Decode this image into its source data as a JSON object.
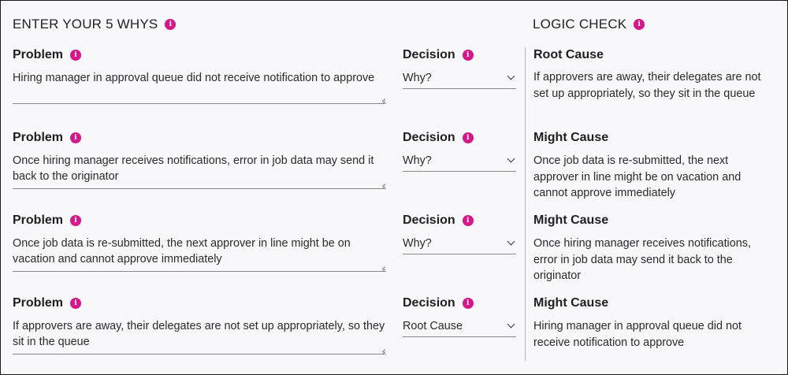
{
  "section_title": "ENTER YOUR 5 WHYS",
  "logic_title": "LOGIC CHECK",
  "rows": [
    {
      "problem_label": "Problem",
      "problem_text": "Hiring manager in approval queue did not receive notification to approve",
      "decision_label": "Decision",
      "decision_value": "Why?",
      "logic_label": "Root Cause",
      "logic_text": "If approvers are away, their delegates are not set up appropriately, so they sit in the queue"
    },
    {
      "problem_label": "Problem",
      "problem_text": "Once hiring manager receives notifications, error in job data may send it back to the originator",
      "decision_label": "Decision",
      "decision_value": "Why?",
      "logic_label": "Might Cause",
      "logic_text": "Once job data is re-submitted, the next approver in line might be on vacation and cannot approve immediately"
    },
    {
      "problem_label": "Problem",
      "problem_text": "Once job data is re-submitted, the next approver in line might be on vacation and cannot approve immediately",
      "decision_label": "Decision",
      "decision_value": "Why?",
      "logic_label": "Might Cause",
      "logic_text": "Once hiring manager receives notifications, error in job data may send it back to the originator"
    },
    {
      "problem_label": "Problem",
      "problem_text": "If approvers are away, their delegates are not set up appropriately, so they sit in the queue",
      "decision_label": "Decision",
      "decision_value": "Root Cause",
      "logic_label": "Might Cause",
      "logic_text": "Hiring manager in approval queue did not receive notification to approve"
    }
  ],
  "info_glyph": "i",
  "colors": {
    "accent": "#d6178a",
    "background": "#f8f8fa"
  },
  "icons": {
    "info": "info-icon",
    "dropdown": "chevron-down-icon",
    "resize": "resize-handle-icon"
  }
}
